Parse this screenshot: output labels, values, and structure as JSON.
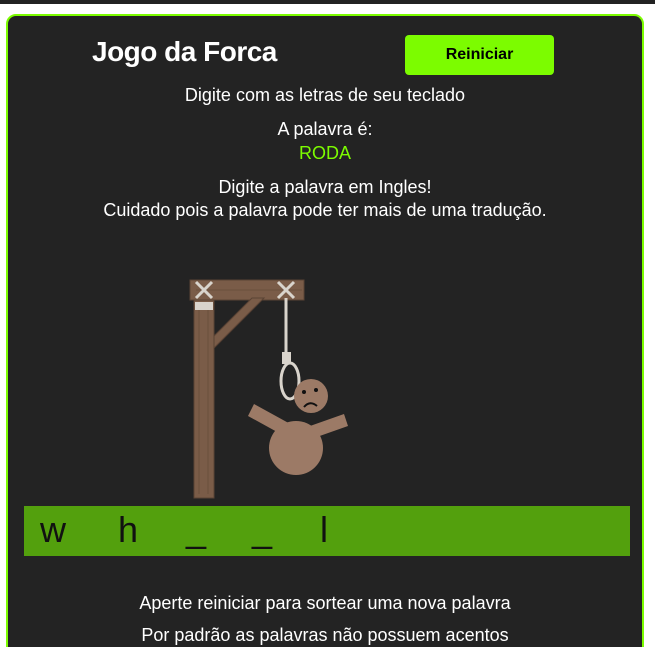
{
  "game": {
    "title": "Jogo da Forca",
    "restart_label": "Reiniciar",
    "instruction": "Digite com as letras de seu teclado",
    "word_label": "A palavra é:",
    "word": "RODA",
    "hint_line1": "Digite a palavra em Ingles!",
    "hint_line2": "Cuidado pois a palavra pode ter mais de uma tradução.",
    "slots": [
      "w",
      "h",
      "_",
      "_",
      "l"
    ],
    "footer_line1": "Aperte reiniciar para sortear uma nova palavra",
    "footer_line2": "Por padrão as palavras não possuem acentos"
  },
  "colors": {
    "accent": "#7cfc00",
    "panel_bg": "#232323",
    "guess_bar": "#53a00d",
    "wood": "#7a5c48",
    "figure": "#9c7a66"
  }
}
